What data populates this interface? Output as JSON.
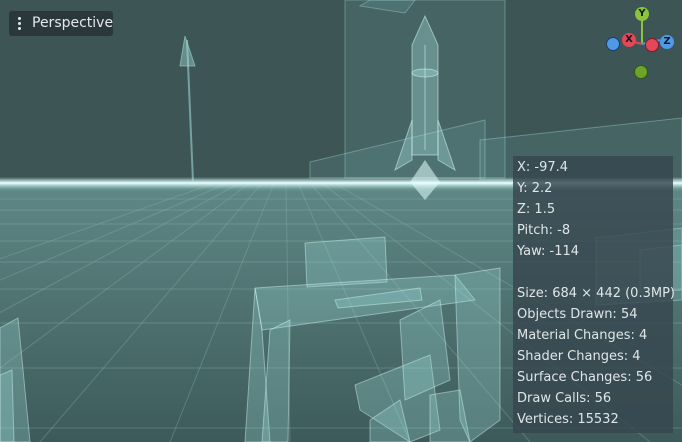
{
  "viewport": {
    "mode_label": "Perspective"
  },
  "gizmo": {
    "y_label": "Y",
    "x_label": "X",
    "z_label": "Z",
    "colors": {
      "y": "#8bc43a",
      "x": "#e44759",
      "z": "#4e9ae8"
    }
  },
  "stats": {
    "x": "X: -97.4",
    "y": "Y: 2.2",
    "z": "Z: 1.5",
    "pitch": "Pitch: -8",
    "yaw": "Yaw: -114",
    "size": "Size: 684 × 442 (0.3MP)",
    "objects_drawn": "Objects Drawn: 54",
    "material_changes": "Material Changes: 4",
    "shader_changes": "Shader Changes: 4",
    "surface_changes": "Surface Changes: 56",
    "draw_calls": "Draw Calls: 56",
    "vertices": "Vertices: 15532"
  }
}
